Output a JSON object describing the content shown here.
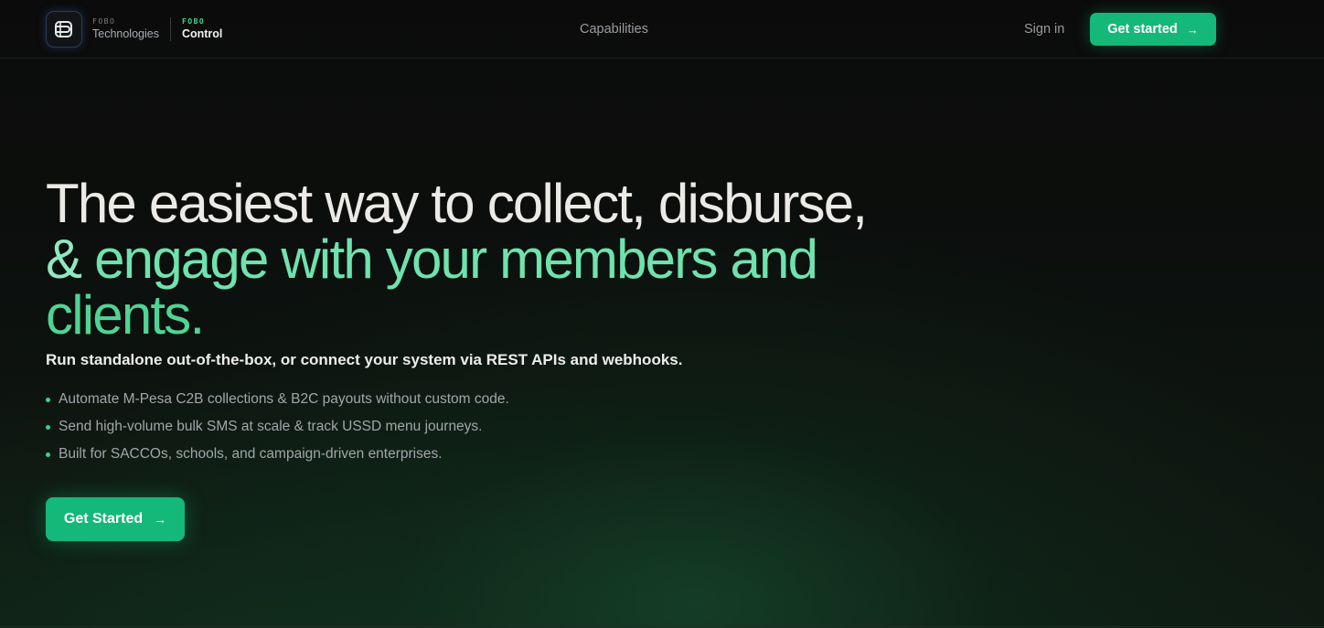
{
  "brand": {
    "company_small": "FOBO",
    "company_name": "Technologies",
    "product_small": "FOBO",
    "product_name": "Control",
    "logo_icon": "fobo-logo-icon"
  },
  "nav": {
    "capabilities": "Capabilities",
    "sign_in": "Sign in",
    "get_started": "Get started"
  },
  "hero": {
    "title_line1": "The easiest way to collect, disburse,",
    "title_line2_amp": "&",
    "title_line2": " engage with your members and",
    "title_line3": "clients.",
    "subtitle": "Run standalone out-of-the-box, or connect your system via REST APIs and webhooks.",
    "bullets": [
      "Automate M-Pesa C2B collections & B2C payouts without custom code.",
      "Send high-volume bulk SMS at scale & track USSD menu journeys.",
      "Built for SACCOs, schools, and campaign-driven enterprises."
    ],
    "cta": "Get Started"
  },
  "icons": {
    "arrow": "→"
  },
  "colors": {
    "accent": "#14b879",
    "accent_text": "#4fd494",
    "background": "#0b0b0b"
  }
}
